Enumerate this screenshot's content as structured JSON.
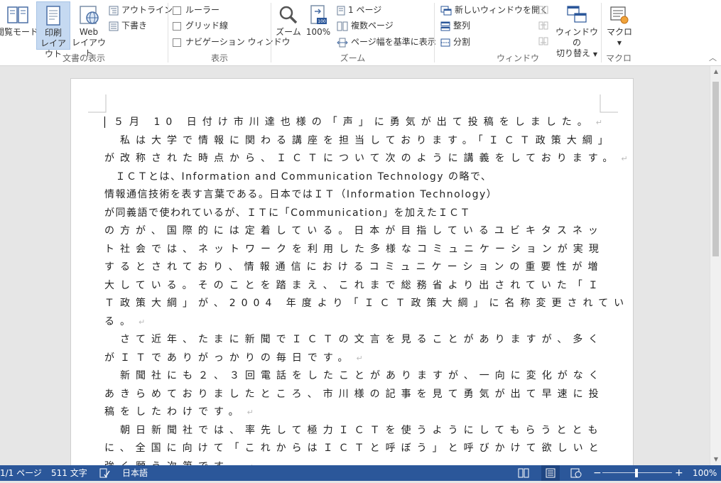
{
  "ribbon": {
    "doc_view": {
      "label": "文書の表示",
      "read_mode": "閲覧モード",
      "print_layout_1": "印刷",
      "print_layout_2": "レイアウト",
      "web_layout_1": "Web",
      "web_layout_2": "レイアウト",
      "outline": "アウトライン",
      "draft": "下書き"
    },
    "show": {
      "label": "表示",
      "ruler": "ルーラー",
      "gridlines": "グリッド線",
      "nav_pane": "ナビゲーション ウィンドウ"
    },
    "zoom": {
      "label": "ズーム",
      "zoom_btn": "ズーム",
      "hundred": "100%",
      "one_page": "1 ページ",
      "multi_page": "複数ページ",
      "page_width": "ページ幅を基準に表示"
    },
    "window": {
      "label": "ウィンドウ",
      "new_window": "新しいウィンドウを開く",
      "arrange": "整列",
      "split": "分割",
      "switch_1": "ウィンドウの",
      "switch_2": "切り替え"
    },
    "macro": {
      "label": "マクロ",
      "macro_btn": "マクロ"
    }
  },
  "document": {
    "lines": [
      "５月 10 日付け市川達也様の「声」に勇気が出て投稿をしました。",
      "　私は大学で情報に関わる講座を担当しております。「ＩＣＴ政策大綱」",
      "が改称された時点から、ＩＣＴについて次のように講義をしております。",
      "　ＩＣＴとは、Information and Communication Technology の略で、",
      "情報通信技術を表す言葉である。日本ではＩＴ（Information Technology）",
      "が同義語で使われているが、ＩＴに「Communication」を加えたＩＣＴ",
      "の方が、国際的には定着している。日本が目指しているユビキタスネッ",
      "ト社会では、ネットワークを利用した多様なコミュニケーションが実現",
      "するとされており、情報通信におけるコミュニケーションの重要性が増",
      "大している。そのことを踏まえ、これまで総務省より出されていた「Ｉ",
      "Ｔ政策大綱」が、2004 年度より「ＩＣＴ政策大綱」に名称変更されてい",
      "る。",
      "　さて近年、たまに新聞でＩＣＴの文言を見ることがありますが、多く",
      "がＩＴでありがっかりの毎日です。",
      "　新聞社にも２、３回電話をしたことがありますが、一向に変化がなく",
      "あきらめておりましたところ、市川様の記事を見て勇気が出て早速に投",
      "稿をしたわけです。",
      "　朝日新聞社では、率先して極力ＩＣＴを使うようにしてもらうととも",
      "に、全国に向けて「これからはＩＣＴと呼ぼう」と呼びかけて欲しいと",
      "強く願う次第です。"
    ],
    "paragraph_ends": [
      0,
      2,
      11,
      13,
      16,
      19
    ]
  },
  "status": {
    "page": "1/1 ページ",
    "words": "511 文字",
    "language": "日本語",
    "zoom_percent": "100%"
  },
  "colors": {
    "statusbar": "#2b579a",
    "active_view": "#c5d9f1"
  }
}
